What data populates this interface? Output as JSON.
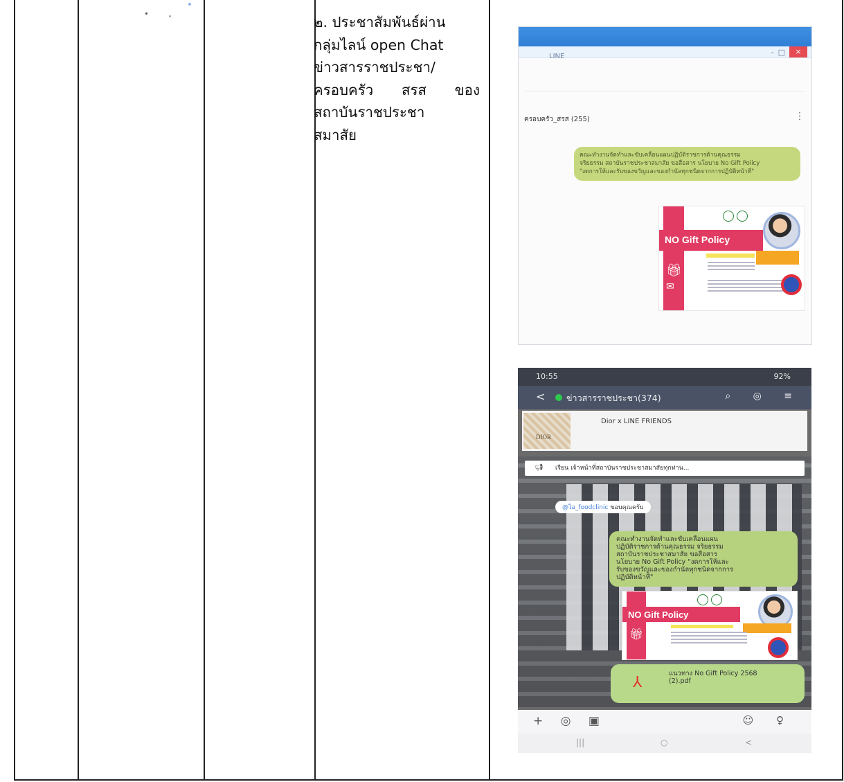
{
  "cell_text": {
    "lines": [
      "๒. ประชาสัมพันธ์ผ่าน",
      "กลุ่มไลน์ open Chat",
      "ข่าวสารราชประชา/",
      "ครอบครัว สรส ของ",
      "สถาบันราชประชา",
      "สมาสัย"
    ]
  },
  "desktop_chat": {
    "window_title": "LINE",
    "minimize_symbol": "-",
    "maximize_symbol": "□",
    "close_symbol": "×",
    "group_name": "ครอบครัว_สรส (255)",
    "menu_symbol": "⋮",
    "message_lines": [
      "คณะทำงานจัดทำและขับเคลื่อนแผนปฏิบัติราชการด้านคุณธรรม",
      "จริยธรรม สถาบันราชประชาสมาสัย ขอสื่อสาร นโยบาย No Gift Policy",
      "\"งดการให้และรับของขวัญและของกำนัลทุกชนิดจากการปฏิบัติหน้าที่\""
    ],
    "poster_text": "NO Gift Policy"
  },
  "mobile_chat": {
    "status_time": "10:55",
    "battery": "92%",
    "back_symbol": "<",
    "group_name": "ข่าวสารราชประชา(374)",
    "header_icons": "⌕ ◎ ≡",
    "ad_title": "Dior x LINE FRIENDS",
    "ad_thumb_text": "DIOR",
    "announcement": "เรียน เจ้าหน้าที่สถาบันราชประชาสมาสัยทุกท่าน...",
    "mention_at": "@ไอ_foodclinic",
    "mention_text": "ขอบคุณครับ",
    "message_lines": [
      "คณะทำงานจัดทำและขับเคลื่อนแผน",
      "ปฏิบัติราชการด้านคุณธรรม    จริยธรรม",
      "สถาบันราชประชาสมาสัย ขอสื่อสาร",
      "นโยบาย No Gift Policy \"งดการให้และ",
      "รับของขวัญและของกำนัลทุกชนิดจากการ",
      "ปฏิบัติหน้าที่\""
    ],
    "poster_text": "NO Gift Policy",
    "pdf_name_lines": [
      "แนวทาง No Gift Policy 2568",
      "(2).pdf"
    ],
    "input_icons_left": "+ ◎ ▣",
    "input_icons_right": "☺ ♀",
    "sys_nav": [
      "|||",
      "○",
      "<"
    ]
  }
}
